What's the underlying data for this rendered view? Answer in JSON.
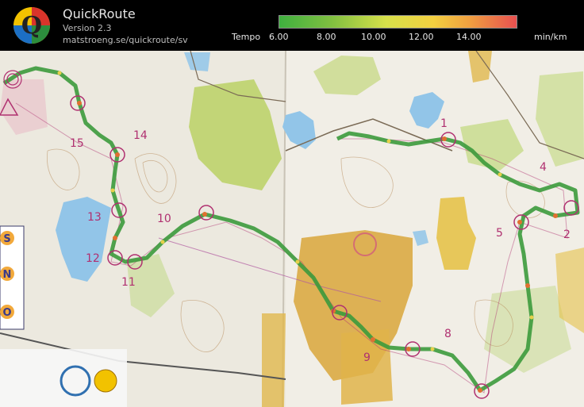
{
  "app": {
    "title": "QuickRoute",
    "version": "Version 2.3",
    "url": "matstroeng.se/quickroute/sv",
    "logo_letter": "Q"
  },
  "legend": {
    "label": "Tempo",
    "ticks": [
      "6.00",
      "8.00",
      "10.00",
      "12.00",
      "14.00"
    ],
    "unit": "min/km",
    "gradient_colors": [
      "#3fb03f",
      "#80c040",
      "#d7e04a",
      "#f3d040",
      "#f0a040",
      "#e85050"
    ]
  },
  "map": {
    "controls": [
      "1",
      "2",
      "4",
      "5",
      "8",
      "9",
      "10",
      "11",
      "12",
      "13",
      "14",
      "15"
    ],
    "side_letters": [
      "S",
      "N",
      "O"
    ],
    "colors": {
      "paper": "#f3efe8",
      "forest": "#dfe6c8",
      "green": "#b8cf5c",
      "yellow_field": "#d9a63a",
      "water": "#92c5e8",
      "route_line": "#3c9a3c",
      "control_circle": "#b03070"
    }
  }
}
